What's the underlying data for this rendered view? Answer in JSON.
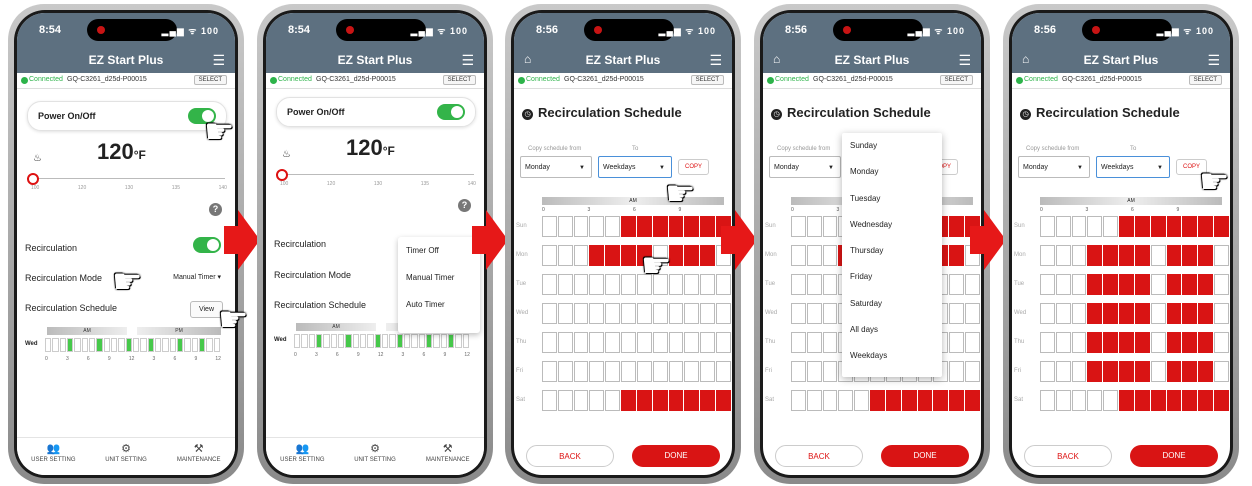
{
  "status": {
    "time1": "8:54",
    "time2": "8:54",
    "time3": "8:56",
    "time4": "8:56",
    "time5": "8:56",
    "icons": "▂▄▆ ᯤ 100"
  },
  "app": {
    "title": "EZ Start Plus",
    "connected": "Connected",
    "device": "GQ-C3261_d25d-P00015",
    "select": "SELECT"
  },
  "home": {
    "power_label": "Power On/Off",
    "temp": "120",
    "temp_unit": "°F",
    "ticks": [
      "100",
      "120",
      "130",
      "135",
      "140"
    ],
    "help": "?",
    "recirculation": "Recirculation",
    "mode_label": "Recirculation Mode",
    "mode_value": "Manual Timer ▾",
    "schedule_label": "Recirculation Schedule",
    "view": "View",
    "mini_day": "Wed",
    "mini_am": "AM",
    "mini_pm": "PM",
    "mini_nums": [
      "0",
      "3",
      "6",
      "9",
      "12",
      "3",
      "6",
      "9",
      "12"
    ],
    "nav": [
      {
        "icon": "👥",
        "label": "USER SETTING"
      },
      {
        "icon": "⚙",
        "label": "UNIT SETTING"
      },
      {
        "icon": "⚒",
        "label": "MAINTENANCE"
      }
    ]
  },
  "popmenu": [
    "Timer Off",
    "Manual Timer",
    "Auto Timer"
  ],
  "schedule": {
    "title": "Recirculation Schedule",
    "copy_from_label": "Copy schedule from",
    "to_label": "To",
    "from_value": "Monday",
    "to_value": "Weekdays",
    "copy": "COPY",
    "am": "AM",
    "nums": [
      "0",
      "3",
      "6",
      "9"
    ],
    "days": [
      "Sun",
      "Mon",
      "Tue",
      "Wed",
      "Thu",
      "Fri",
      "Sat"
    ],
    "back": "BACK",
    "done": "DONE"
  },
  "dropdown": [
    "Sunday",
    "Monday",
    "Tuesday",
    "Wednesday",
    "Thursday",
    "Friday",
    "Saturday",
    "All days",
    "Weekdays"
  ]
}
